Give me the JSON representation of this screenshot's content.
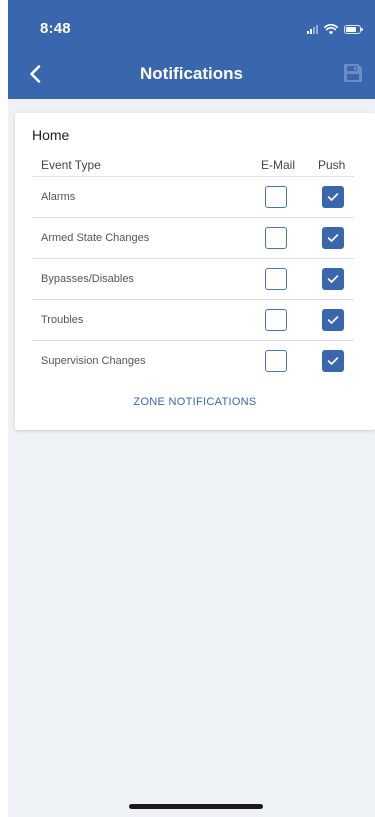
{
  "status_bar": {
    "time": "8:48"
  },
  "nav": {
    "title": "Notifications",
    "back_icon": "chevron-left-icon",
    "save_icon": "floppy-disk-icon"
  },
  "section": {
    "title": "Home"
  },
  "columns": {
    "event_type": "Event Type",
    "email": "E-Mail",
    "push": "Push"
  },
  "events": [
    {
      "label": "Alarms",
      "email": false,
      "push": true
    },
    {
      "label": "Armed State Changes",
      "email": false,
      "push": true
    },
    {
      "label": "Bypasses/Disables",
      "email": false,
      "push": true
    },
    {
      "label": "Troubles",
      "email": false,
      "push": true
    },
    {
      "label": "Supervision Changes",
      "email": false,
      "push": true
    }
  ],
  "zone_notifications_link": "ZONE NOTIFICATIONS",
  "colors": {
    "header_bg": "#3a66ad",
    "checkbox_checked": "#3a66ad",
    "page_bg": "#eef1f5"
  }
}
